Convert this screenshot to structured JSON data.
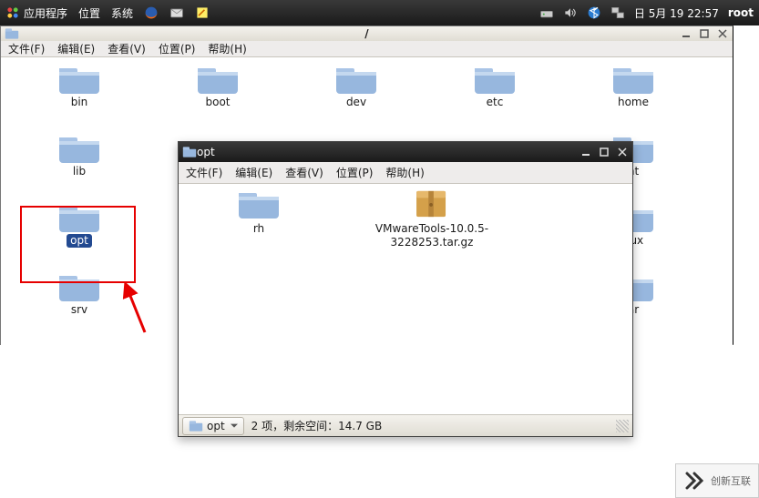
{
  "panel": {
    "apps": "应用程序",
    "places": "位置",
    "system": "系统",
    "clock": "日 5月 19 22:57",
    "user": "root"
  },
  "root_window": {
    "title": "/",
    "menus": {
      "file": "文件(F)",
      "edit": "编辑(E)",
      "view": "查看(V)",
      "places": "位置(P)",
      "help": "帮助(H)"
    },
    "folders": [
      "bin",
      "boot",
      "dev",
      "etc",
      "home",
      "lib",
      "",
      "",
      "",
      "nt",
      "opt",
      "",
      "",
      "",
      "nux",
      "srv",
      "",
      "",
      "",
      "ar"
    ]
  },
  "opt_window": {
    "title": "opt",
    "menus": {
      "file": "文件(F)",
      "edit": "编辑(E)",
      "view": "查看(V)",
      "places": "位置(P)",
      "help": "帮助(H)"
    },
    "items": {
      "rh": "rh",
      "archive": "VMwareTools-10.0.5-3228253.tar.gz"
    },
    "path_btn": "opt",
    "status": "2 项，剩余空间：14.7 GB"
  },
  "watermark": "创新互联"
}
